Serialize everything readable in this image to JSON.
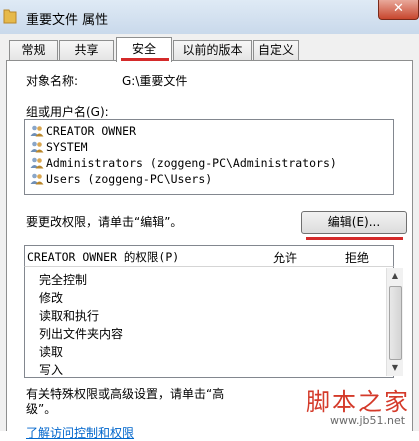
{
  "window": {
    "title": "重要文件 属性",
    "close_label": "✕"
  },
  "tabs": [
    {
      "label": "常规",
      "active": false
    },
    {
      "label": "共享",
      "active": false
    },
    {
      "label": "安全",
      "active": true
    },
    {
      "label": "以前的版本",
      "active": false
    },
    {
      "label": "自定义",
      "active": false
    }
  ],
  "security": {
    "object_name_label": "对象名称:",
    "object_name_value": "G:\\重要文件",
    "groups_label": "组或用户名(G):",
    "groups": [
      "CREATOR OWNER",
      "SYSTEM",
      "Administrators (zoggeng-PC\\Administrators)",
      "Users (zoggeng-PC\\Users)"
    ],
    "change_hint": "要更改权限，请单击“编辑”。",
    "edit_button": "编辑(E)...",
    "permissions_header": "CREATOR OWNER 的权限(P)",
    "allow_header": "允许",
    "deny_header": "拒绝",
    "permissions": [
      "完全控制",
      "修改",
      "读取和执行",
      "列出文件夹内容",
      "读取",
      "写入"
    ],
    "advanced_hint_line1": "有关特殊权限或高级设置，请单击“高",
    "advanced_hint_line2": "级”。",
    "bottom_link_partial": "了解访问控制和权限"
  },
  "watermark": {
    "text": "脚本之家",
    "url": "www.jb51.net"
  }
}
